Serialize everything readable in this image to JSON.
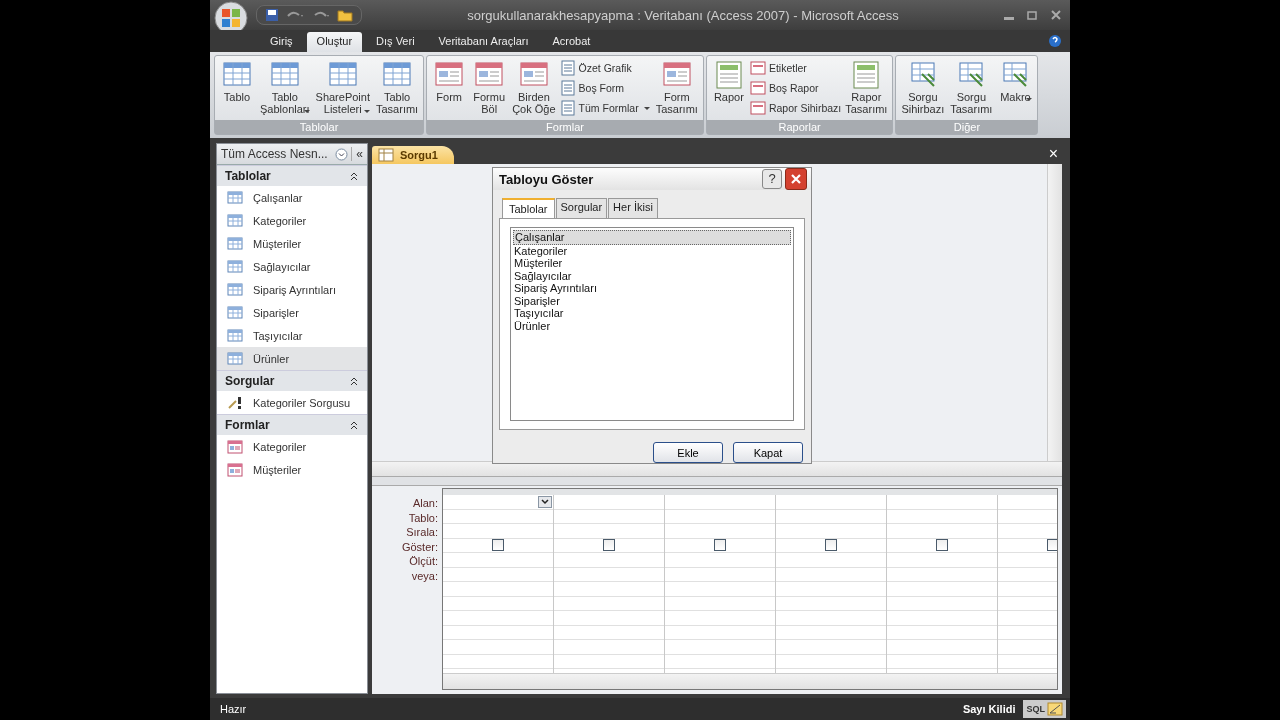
{
  "window": {
    "title": "sorgukullanarakhesapyapma : Veritabanı (Access 2007) - Microsoft Access"
  },
  "ribbon": {
    "tabs": [
      {
        "label": "Giriş",
        "selected": false
      },
      {
        "label": "Oluştur",
        "selected": true
      },
      {
        "label": "Dış Veri",
        "selected": false
      },
      {
        "label": "Veritabanı Araçları",
        "selected": false
      },
      {
        "label": "Acrobat",
        "selected": false
      }
    ],
    "groups": [
      {
        "label": "Tablolar",
        "buttons": [
          {
            "label": "Tablo",
            "kind": "large",
            "dropdown": false
          },
          {
            "label": "Tablo\nŞablonları",
            "kind": "large",
            "dropdown": true
          },
          {
            "label": "SharePoint\nListeleri",
            "kind": "large",
            "dropdown": true
          },
          {
            "label": "Tablo\nTasarımı",
            "kind": "large",
            "dropdown": false
          }
        ]
      },
      {
        "label": "Formlar",
        "buttons": [
          {
            "label": "Form",
            "kind": "large",
            "dropdown": false
          },
          {
            "label": "Formu\nBöl",
            "kind": "large",
            "dropdown": false
          },
          {
            "label": "Birden\nÇok Öğe",
            "kind": "large",
            "dropdown": false
          },
          {
            "label": "Özet Grafik",
            "kind": "small",
            "dropdown": false
          },
          {
            "label": "Boş Form",
            "kind": "small",
            "dropdown": false
          },
          {
            "label": "Tüm Formlar",
            "kind": "small",
            "dropdown": true
          },
          {
            "label": "Form\nTasarımı",
            "kind": "large",
            "dropdown": false
          }
        ]
      },
      {
        "label": "Raporlar",
        "buttons": [
          {
            "label": "Rapor",
            "kind": "large",
            "dropdown": false
          },
          {
            "label": "Etiketler",
            "kind": "small",
            "dropdown": false
          },
          {
            "label": "Boş Rapor",
            "kind": "small",
            "dropdown": false
          },
          {
            "label": "Rapor Sihirbazı",
            "kind": "small",
            "dropdown": false
          },
          {
            "label": "Rapor\nTasarımı",
            "kind": "large",
            "dropdown": false
          }
        ]
      },
      {
        "label": "Diğer",
        "buttons": [
          {
            "label": "Sorgu\nSihirbazı",
            "kind": "large",
            "dropdown": false
          },
          {
            "label": "Sorgu\nTasarımı",
            "kind": "large",
            "dropdown": false
          },
          {
            "label": "Makro",
            "kind": "large",
            "dropdown": true
          }
        ]
      }
    ]
  },
  "nav_pane": {
    "title": "Tüm Access Nesn...",
    "collapse": "«",
    "groups": [
      {
        "label": "Tablolar",
        "expanded": true,
        "items": [
          {
            "label": "Çalışanlar",
            "kind": "table",
            "selected": false
          },
          {
            "label": "Kategoriler",
            "kind": "table",
            "selected": false
          },
          {
            "label": "Müşteriler",
            "kind": "table",
            "selected": false
          },
          {
            "label": "Sağlayıcılar",
            "kind": "table",
            "selected": false
          },
          {
            "label": "Sipariş Ayrıntıları",
            "kind": "table",
            "selected": false
          },
          {
            "label": "Siparişler",
            "kind": "table",
            "selected": false
          },
          {
            "label": "Taşıyıcılar",
            "kind": "table",
            "selected": false
          },
          {
            "label": "Ürünler",
            "kind": "table",
            "selected": true
          }
        ]
      },
      {
        "label": "Sorgular",
        "expanded": true,
        "items": [
          {
            "label": "Kategoriler Sorgusu",
            "kind": "query",
            "selected": false
          }
        ]
      },
      {
        "label": "Formlar",
        "expanded": true,
        "items": [
          {
            "label": "Kategoriler",
            "kind": "form",
            "selected": false
          },
          {
            "label": "Müşteriler",
            "kind": "form",
            "selected": false
          }
        ]
      }
    ]
  },
  "document_tabs": [
    {
      "label": "Sorgu1",
      "selected": true
    }
  ],
  "close_document": "×",
  "dialog": {
    "title": "Tabloyu Göster",
    "help": "?",
    "tabs": [
      {
        "label": "Tablolar",
        "selected": true
      },
      {
        "label": "Sorgular",
        "selected": false
      },
      {
        "label": "Her İkisi",
        "selected": false
      }
    ],
    "items": [
      {
        "label": "Çalışanlar",
        "selected": true
      },
      {
        "label": "Kategoriler",
        "selected": false
      },
      {
        "label": "Müşteriler",
        "selected": false
      },
      {
        "label": "Sağlayıcılar",
        "selected": false
      },
      {
        "label": "Sipariş Ayrıntıları",
        "selected": false
      },
      {
        "label": "Siparişler",
        "selected": false
      },
      {
        "label": "Taşıyıcılar",
        "selected": false
      },
      {
        "label": "Ürünler",
        "selected": false
      }
    ],
    "buttons": [
      "Ekle",
      "Kapat"
    ]
  },
  "query_grid": {
    "row_labels": [
      "Alan:",
      "Tablo:",
      "Sırala:",
      "Göster:",
      "Ölçüt:",
      "veya:"
    ],
    "columns": [
      {
        "show": false
      },
      {
        "show": false
      },
      {
        "show": false
      },
      {
        "show": false
      },
      {
        "show": false
      },
      {
        "show": false
      }
    ]
  },
  "status_bar": {
    "left": "Hazır",
    "right": "Sayı Kilidi",
    "view_buttons": [
      "SQL"
    ]
  }
}
